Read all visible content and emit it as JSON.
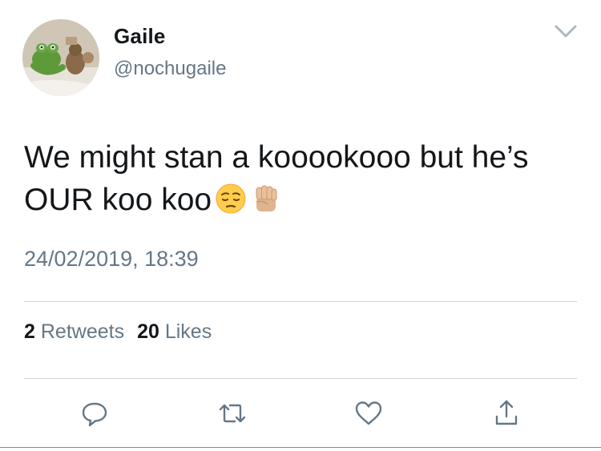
{
  "user": {
    "display_name": "Gaile",
    "handle": "@nochugaile"
  },
  "tweet": {
    "text": "We might stan a kooookooo but he’s OUR koo koo",
    "emojis": [
      "pensive-face-emoji",
      "raised-fist-emoji"
    ],
    "timestamp": "24/02/2019, 18:39"
  },
  "stats": {
    "retweets_count": "2",
    "retweets_label": "Retweets",
    "likes_count": "20",
    "likes_label": "Likes"
  },
  "icons": {
    "menu": "chevron-down-icon",
    "reply": "reply-icon",
    "retweet": "retweet-icon",
    "like": "heart-icon",
    "share": "share-icon"
  },
  "colors": {
    "text_primary": "#14171a",
    "text_secondary": "#657786",
    "divider": "#ccd6dd",
    "icon": "#657786"
  }
}
